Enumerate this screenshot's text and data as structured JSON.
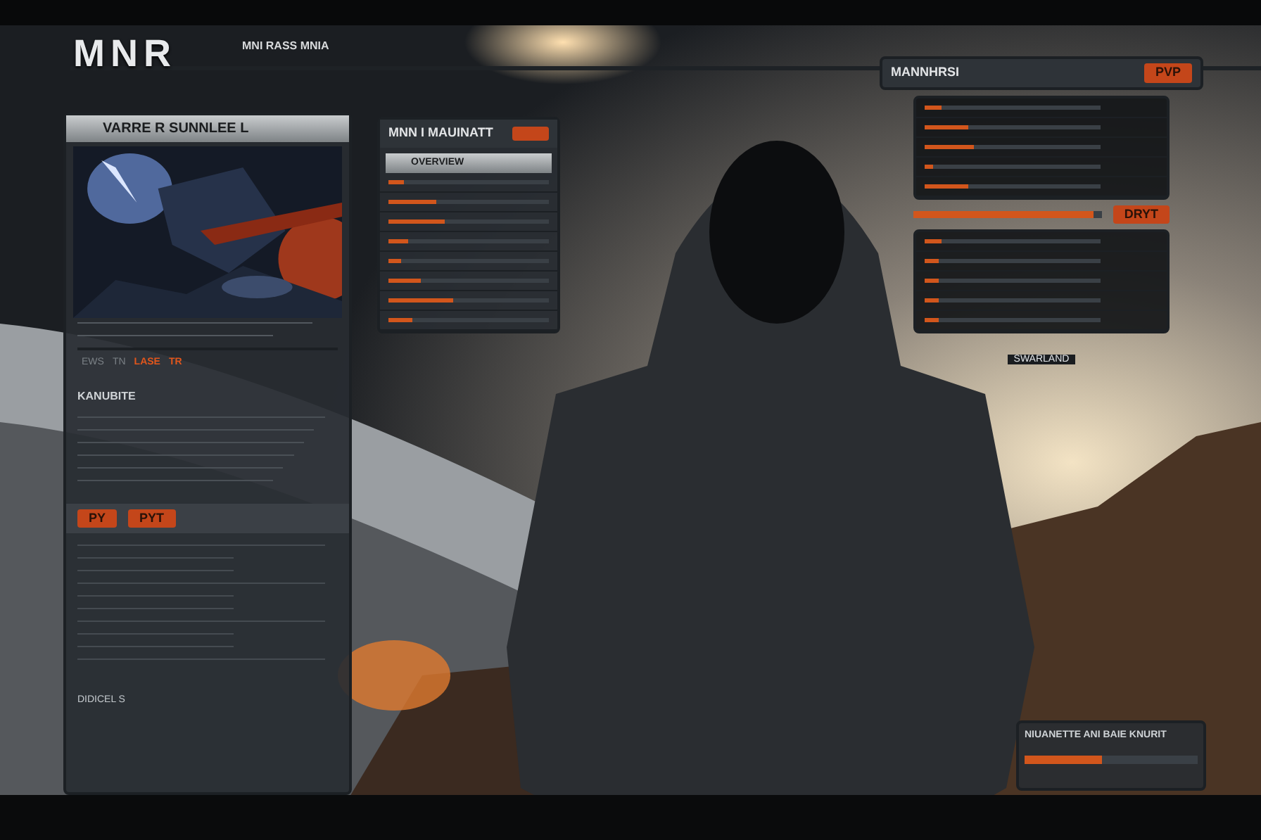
{
  "header": {
    "logo": "MNR",
    "nav_text": "MNI RASS MNIA"
  },
  "news_panel": {
    "title": "VARRE R SUNNLEE L",
    "tabs": [
      {
        "label": "EWS",
        "selected": false
      },
      {
        "label": "TN",
        "selected": false
      },
      {
        "label": "LASE",
        "selected": true
      },
      {
        "label": "TR",
        "selected": true
      }
    ],
    "section_title": "KANUBITE",
    "buttons": [
      "PY",
      "PYT"
    ],
    "footer": "DIDICEL S"
  },
  "match_panel": {
    "title": "MNN I MAUINATT",
    "subtitle": "OVERVIEW",
    "rows": [
      {
        "level": 0.1
      },
      {
        "level": 0.3
      },
      {
        "level": 0.35
      },
      {
        "level": 0.12
      },
      {
        "level": 0.08
      },
      {
        "level": 0.2
      },
      {
        "level": 0.4
      },
      {
        "level": 0.15
      }
    ]
  },
  "stats_panel": {
    "title": "MANNHRSI",
    "mode_button": "PVP",
    "action_button": "DRYT",
    "rows": [
      {
        "level": 0.1
      },
      {
        "level": 0.25
      },
      {
        "level": 0.28
      },
      {
        "level": 0.05
      },
      {
        "level": 0.25
      }
    ],
    "progress": {
      "level": 0.96
    },
    "rows_2": [
      {
        "level": 0.1
      },
      {
        "level": 0.08
      },
      {
        "level": 0.08
      },
      {
        "level": 0.08
      },
      {
        "level": 0.08
      }
    ],
    "footer": "SWARLAND"
  },
  "notice_panel": {
    "title": "NIUANETTE ANI BAIE KNURIT",
    "progress": {
      "level": 0.45
    }
  }
}
